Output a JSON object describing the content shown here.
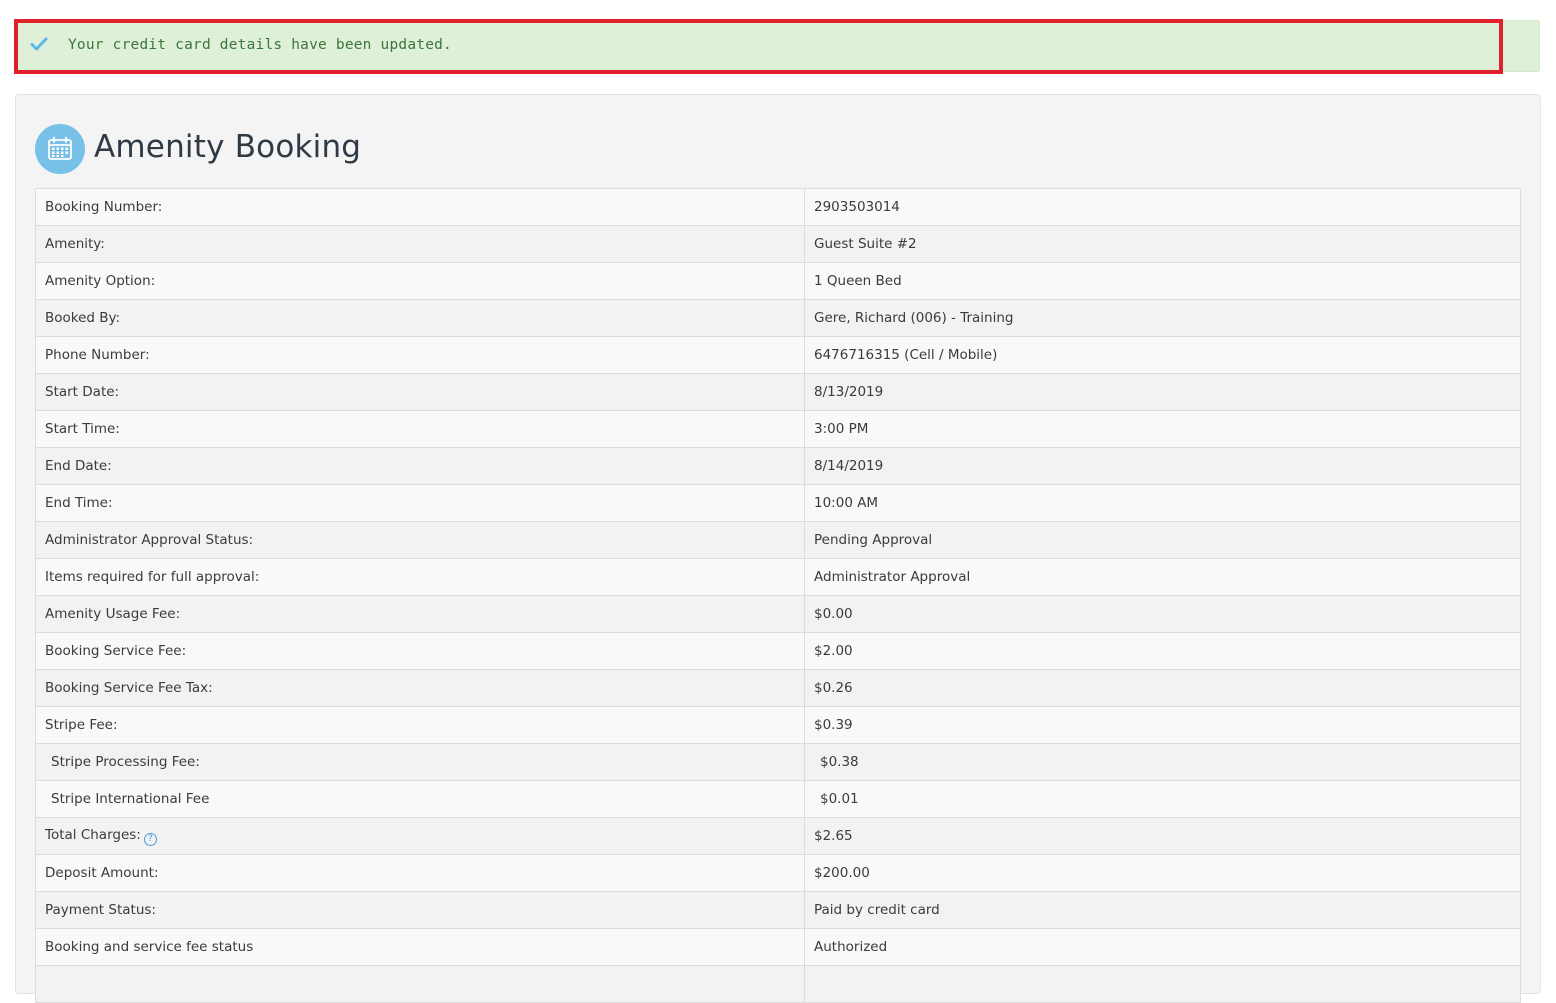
{
  "alert": {
    "message": "Your credit card details have been updated.",
    "icon": "checkmark-icon",
    "color": "#3c763d",
    "background": "#dff0d8",
    "highlight_color": "#e0212b"
  },
  "page": {
    "title": "Amenity Booking",
    "title_icon": "calendar-icon",
    "icon_color": "#77c0e8"
  },
  "details": {
    "rows": [
      {
        "label": "Booking Number:",
        "value": "2903503014"
      },
      {
        "label": "Amenity:",
        "value": "Guest Suite #2"
      },
      {
        "label": "Amenity Option:",
        "value": "1 Queen Bed"
      },
      {
        "label": "Booked By:",
        "value": "Gere, Richard (006) - Training"
      },
      {
        "label": "Phone Number:",
        "value": "6476716315 (Cell / Mobile)"
      },
      {
        "label": "Start Date:",
        "value": "8/13/2019"
      },
      {
        "label": "Start Time:",
        "value": "3:00 PM"
      },
      {
        "label": "End Date:",
        "value": "8/14/2019"
      },
      {
        "label": "End Time:",
        "value": "10:00 AM"
      },
      {
        "label": "Administrator Approval Status:",
        "value": "Pending Approval"
      },
      {
        "label": "Items required for full approval:",
        "value": "Administrator Approval"
      },
      {
        "label": "Amenity Usage Fee:",
        "value": "$0.00"
      },
      {
        "label": "Booking Service Fee:",
        "value": "$2.00"
      },
      {
        "label": "Booking Service Fee Tax:",
        "value": "$0.26"
      },
      {
        "label": "Stripe Fee:",
        "value": "$0.39"
      },
      {
        "label": "Stripe Processing Fee:",
        "value": "$0.38"
      },
      {
        "label": "Stripe International Fee",
        "value": "$0.01"
      },
      {
        "label": "Total Charges:",
        "value": "$2.65",
        "help": "?"
      },
      {
        "label": "Deposit Amount:",
        "value": "$200.00"
      },
      {
        "label": "Payment Status:",
        "value": "Paid by credit card"
      },
      {
        "label": "Booking and service fee status",
        "value": "Authorized"
      },
      {
        "label": "",
        "value": ""
      }
    ]
  }
}
